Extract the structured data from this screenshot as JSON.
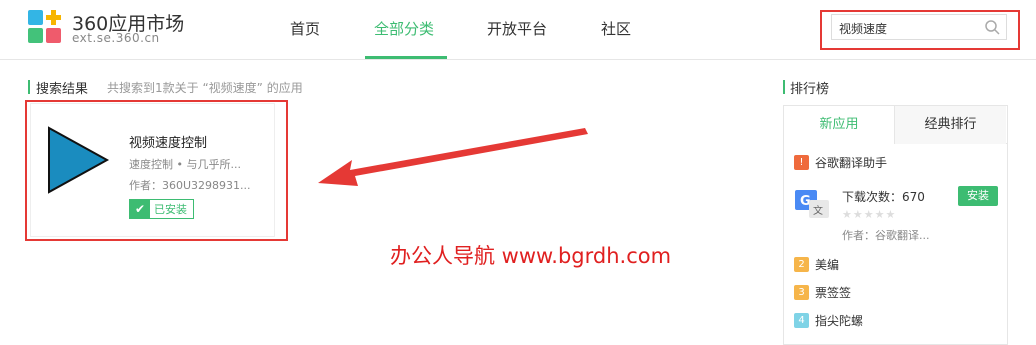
{
  "header": {
    "logo_title": "360应用市场",
    "logo_sub": "ext.se.360.cn",
    "nav": [
      "首页",
      "全部分类",
      "开放平台",
      "社区"
    ],
    "active_nav": "全部分类",
    "search_value": "视频速度"
  },
  "results": {
    "title": "搜索结果",
    "summary": "共搜索到1款关于 “视频速度” 的应用",
    "app": {
      "name": "视频速度控制",
      "desc": "速度控制 • 与几乎所...",
      "author": "作者：360U3298931...",
      "status": "已安装",
      "check_icon": "✔"
    }
  },
  "watermark": "办公人导航  www.bgrdh.com",
  "ranking": {
    "title": "排行榜",
    "tabs": [
      "新应用",
      "经典排行"
    ],
    "items": [
      {
        "rank": "!",
        "name": "谷歌翻译助手"
      },
      {
        "rank": "2",
        "name": "美编"
      },
      {
        "rank": "3",
        "name": "票签签"
      },
      {
        "rank": "4",
        "name": "指尖陀螺"
      }
    ],
    "top_item": {
      "downloads": "下载次数：670",
      "stars": "★★★★★",
      "author": "作者：谷歌翻译...",
      "install_label": "安装"
    }
  },
  "colors": {
    "accent": "#3dbc72",
    "highlight_red": "#e53935",
    "app_icon_blue": "#1a8cbf"
  }
}
